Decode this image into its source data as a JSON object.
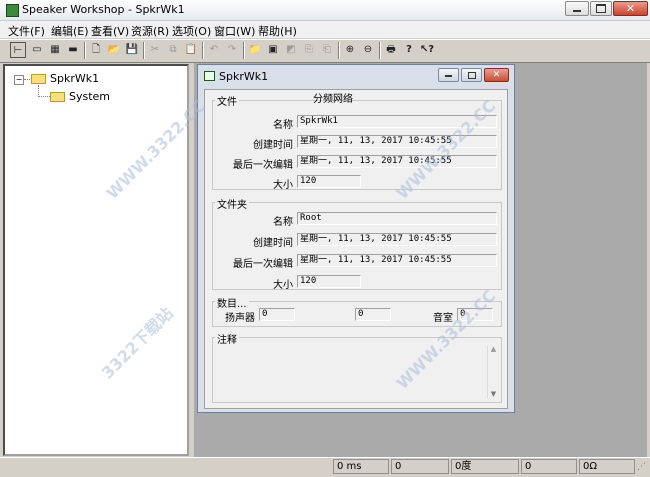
{
  "app": {
    "title": "Speaker Workshop - SpkrWk1"
  },
  "menu": [
    "文件(F)",
    "编辑(E)",
    "查看(V)",
    "资源(R)",
    "选项(O)",
    "窗口(W)",
    "帮助(H)"
  ],
  "tree": {
    "root": "SpkrWk1",
    "child": "System"
  },
  "child_window": {
    "title": "SpkrWk1"
  },
  "file_group": {
    "label": "文件",
    "name_label": "名称",
    "name_value": "SpkrWk1",
    "created_label": "创建时间",
    "created_value": "星期一, 11, 13, 2017 10:45:55",
    "edited_label": "最后一次编辑",
    "edited_value": "星期一, 11, 13, 2017 10:45:55",
    "size_label": "大小",
    "size_value": "120"
  },
  "folder_group": {
    "label": "文件夹",
    "name_label": "名称",
    "name_value": "Root",
    "created_label": "创建时间",
    "created_value": "星期一, 11, 13, 2017 10:45:55",
    "edited_label": "最后一次编辑",
    "edited_value": "星期一, 11, 13, 2017 10:45:55",
    "size_label": "大小",
    "size_value": "120"
  },
  "count_group": {
    "label": "数目...",
    "speaker_label": "扬声器",
    "speaker_value": "0",
    "crossover_label": "分频网络",
    "crossover_value": "0",
    "room_label": "音室",
    "room_value": "0"
  },
  "notes_group": {
    "label": "注释"
  },
  "statusbar": {
    "ms": "0 ms",
    "val": "0",
    "deg": "0度",
    "val2": "0",
    "ohm": "0Ω"
  },
  "watermark": "WWW.3322.CC",
  "watermark2": "3322下载站",
  "icons": [
    "tree-icon",
    "list-icon",
    "new-icon",
    "open-icon",
    "save-icon",
    "cut-icon",
    "copy-icon",
    "paste-icon",
    "undo-icon",
    "redo-icon",
    "zoom-in-icon",
    "zoom-out-icon",
    "print-icon",
    "help-icon",
    "context-help-icon"
  ]
}
